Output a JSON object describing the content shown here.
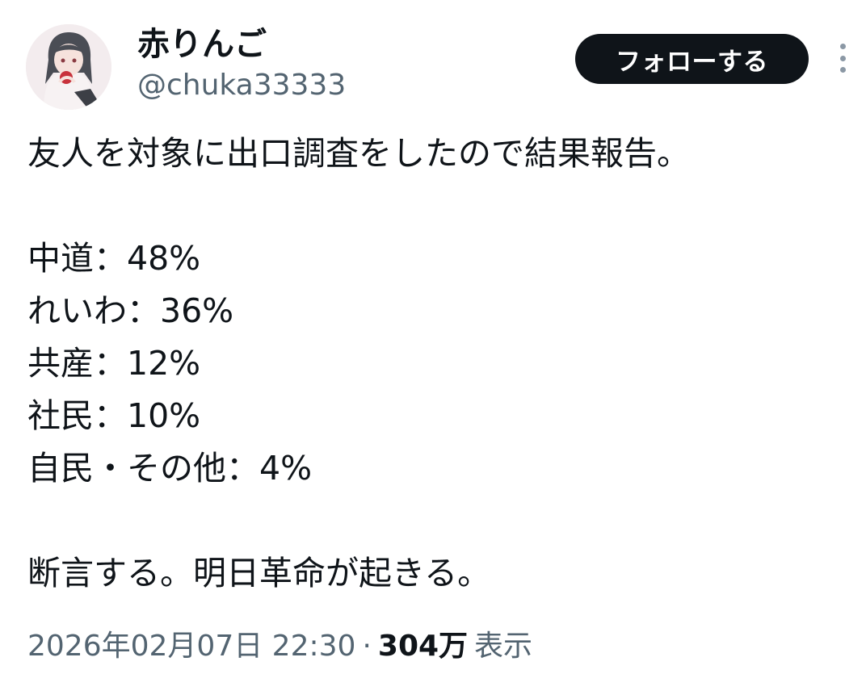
{
  "user": {
    "display_name": "赤りんご",
    "handle": "@chuka33333",
    "avatar_icon": "avatar-illustration"
  },
  "actions": {
    "follow_label": "フォローする",
    "more_icon": "more-options-icon"
  },
  "tweet": {
    "lines": [
      "友人を対象に出口調査をしたので結果報告。",
      "",
      "中道：48%",
      "れいわ：36%",
      "共産：12%",
      "社民：10%",
      "自民・その他：4%",
      "",
      "断言する。明日革命が起きる。"
    ]
  },
  "meta": {
    "timestamp": "2026年02月07日 22:30",
    "separator": "·",
    "views_count": "304万",
    "views_label": "表示"
  },
  "colors": {
    "text": "#0f1419",
    "secondary": "#536471",
    "button_bg": "#0f1419",
    "button_text": "#ffffff",
    "background": "#ffffff"
  }
}
